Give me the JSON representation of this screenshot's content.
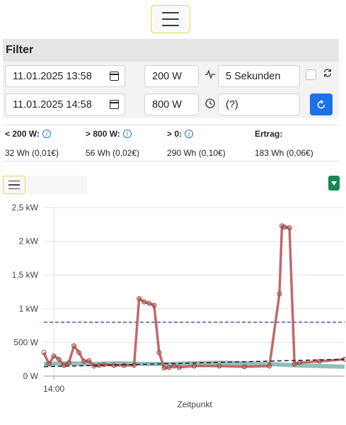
{
  "header": {
    "menu_icon": "hamburger-icon"
  },
  "filter": {
    "title": "Filter",
    "start_datetime": "11.01.2025 13:58",
    "end_datetime": "11.01.2025 14:58",
    "lower_threshold": "200 W",
    "upper_threshold": "800 W",
    "interval": "5 Sekunden",
    "time_field": "(?)",
    "auto_refresh_checked": false,
    "colors": {
      "refresh_button": "#1b72e8"
    }
  },
  "stats": [
    {
      "label": "< 200 W:",
      "value": "32 Wh (0,01€)",
      "has_info": true
    },
    {
      "label": "> 800 W:",
      "value": "56 Wh (0,02€)",
      "has_info": true
    },
    {
      "label": "> 0:",
      "value": "290 Wh (0,10€)",
      "has_info": true
    },
    {
      "label": "Ertrag:",
      "value": "183 Wh (0,06€)",
      "has_info": false
    }
  ],
  "chart_data": {
    "type": "line",
    "xlabel": "Zeitpunkt",
    "ylabel": "",
    "x_tick_labels": [
      "14:00"
    ],
    "y_tick_labels": [
      "0 W",
      "500 W",
      "1 kW",
      "1,5 kW",
      "2 kW",
      "2,5 kW"
    ],
    "ylim": [
      0,
      2500
    ],
    "x_range_minutes": [
      0,
      60
    ],
    "grid": true,
    "reference_line": {
      "value": 800,
      "color": "#5050c8",
      "style": "dashed"
    },
    "series": [
      {
        "color": "#b85a5a",
        "x": [
          0,
          1,
          2,
          3,
          4,
          5,
          6,
          7,
          8,
          9,
          10,
          11,
          12,
          14,
          16,
          18,
          19,
          20,
          21,
          22,
          23,
          24,
          25,
          26,
          27,
          30,
          35,
          40,
          45,
          47,
          47.5,
          48,
          49,
          50,
          51,
          55,
          60
        ],
        "values": [
          350,
          180,
          300,
          250,
          160,
          200,
          450,
          350,
          220,
          230,
          150,
          160,
          170,
          160,
          160,
          160,
          1150,
          1100,
          1080,
          1050,
          350,
          120,
          130,
          150,
          130,
          150,
          150,
          140,
          150,
          1220,
          2230,
          2210,
          2200,
          180,
          200,
          220,
          250
        ]
      },
      {
        "color": "#6aa9a3",
        "x": [
          0,
          5,
          10,
          15,
          20,
          25,
          30,
          35,
          40,
          45,
          50,
          55,
          60
        ],
        "values": [
          180,
          190,
          180,
          190,
          180,
          180,
          190,
          200,
          190,
          180,
          160,
          150,
          140
        ]
      },
      {
        "color": "#222222",
        "style": "dashed",
        "x": [
          0,
          60
        ],
        "values": [
          140,
          250
        ]
      }
    ]
  },
  "chart_toolbar": {
    "menu_icon": "hamburger-icon",
    "dropdown_icon": "caret-down-icon",
    "dropdown_color": "#198754"
  }
}
